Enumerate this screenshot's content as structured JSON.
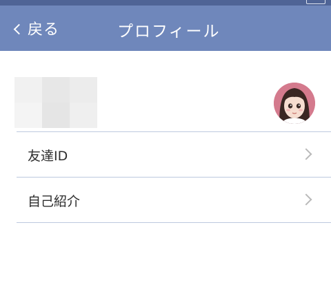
{
  "navbar": {
    "back_label": "戻る",
    "title": "プロフィール"
  },
  "profile": {
    "name_obscured": true
  },
  "rows": [
    {
      "label": "友達ID"
    },
    {
      "label": "自己紹介"
    }
  ],
  "colors": {
    "navbar_bg": "#6f87bb",
    "status_bg": "#4f6496",
    "divider": "#bcc8de",
    "text": "#2d2d2d",
    "chevron": "#b9b9b9",
    "mosaic": [
      "#f1f1f1",
      "#e7e7e7",
      "#ececec",
      "#f4f4f4",
      "#e5e5e5",
      "#efefef"
    ]
  },
  "icons": {
    "back": "chevron-left-icon",
    "row_disclosure": "chevron-right-icon",
    "avatar": "avatar-image"
  }
}
